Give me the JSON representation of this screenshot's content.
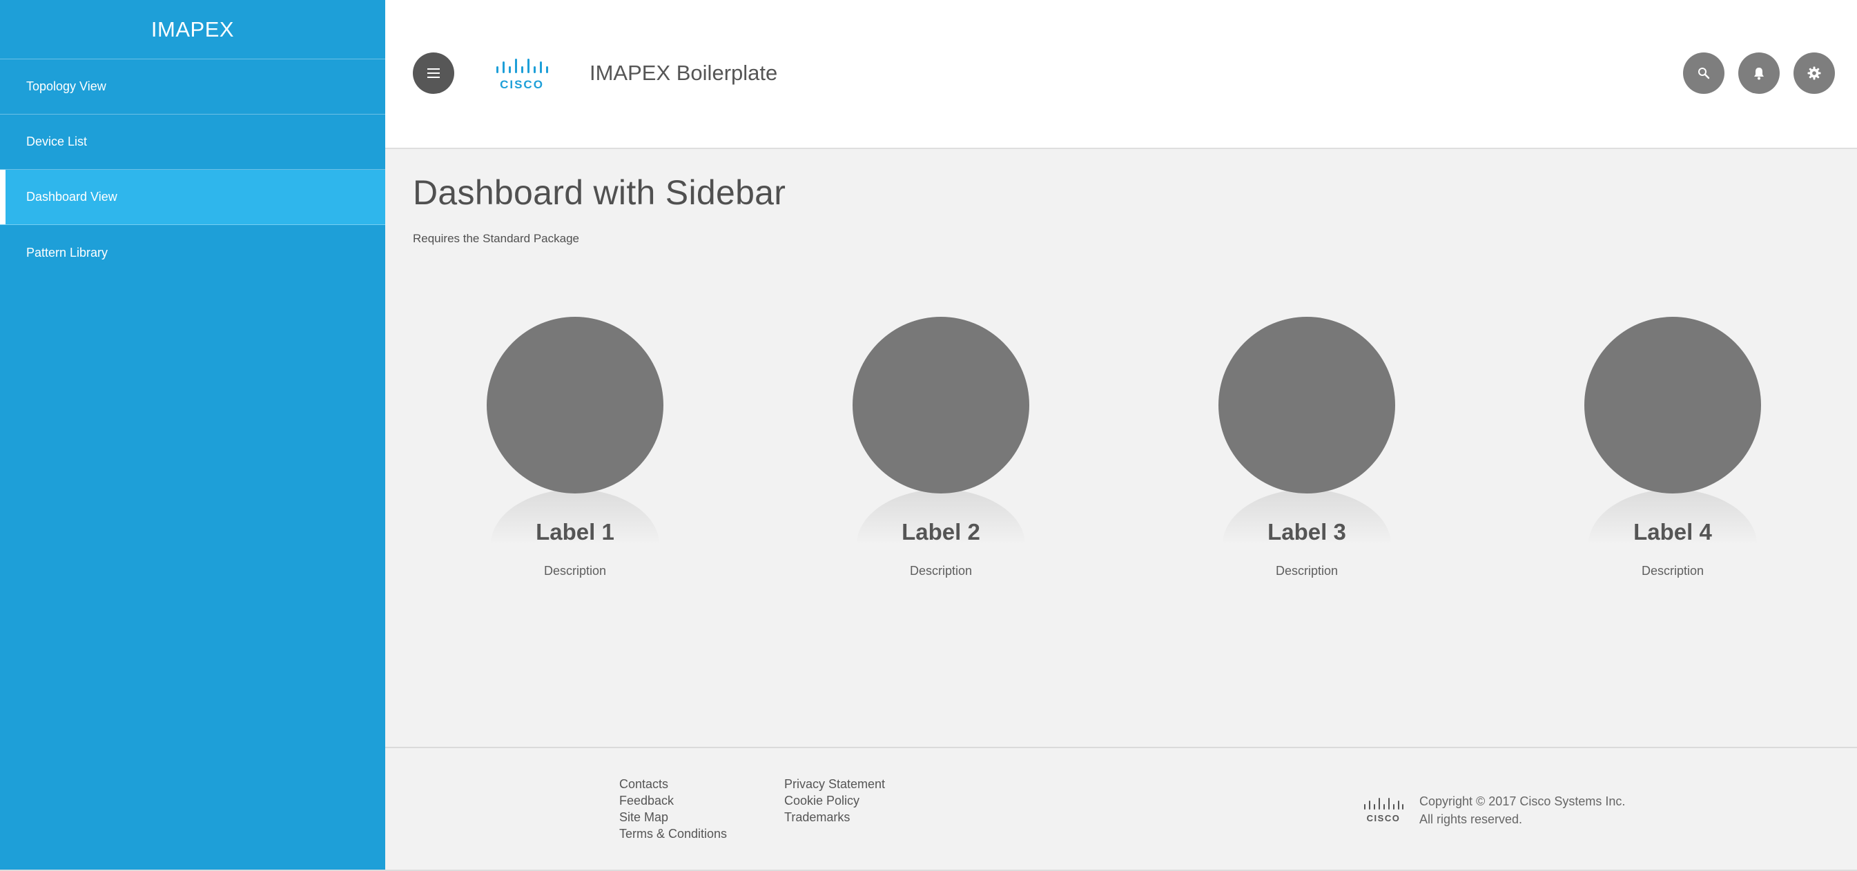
{
  "sidebar": {
    "title": "IMAPEX",
    "items": [
      {
        "label": "Topology View"
      },
      {
        "label": "Device List"
      },
      {
        "label": "Dashboard View"
      },
      {
        "label": "Pattern Library"
      }
    ],
    "active_item": "Dashboard View"
  },
  "header": {
    "logo_text": "CISCO",
    "title": "IMAPEX Boilerplate",
    "menu_icon": "hamburger-menu-icon",
    "icons": [
      "search-icon",
      "bell-icon",
      "gear-icon"
    ]
  },
  "main": {
    "title": "Dashboard with Sidebar",
    "subtitle": "Requires the Standard Package",
    "cards": [
      {
        "label": "Label 1",
        "description": "Description"
      },
      {
        "label": "Label 2",
        "description": "Description"
      },
      {
        "label": "Label 3",
        "description": "Description"
      },
      {
        "label": "Label 4",
        "description": "Description"
      }
    ]
  },
  "footer": {
    "links_col1": [
      "Contacts",
      "Feedback",
      "Site Map",
      "Terms & Conditions"
    ],
    "links_col2": [
      "Privacy Statement",
      "Cookie Policy",
      "Trademarks"
    ],
    "logo_text": "CISCO",
    "copyright_line1": "Copyright © 2017 Cisco Systems Inc.",
    "copyright_line2": "All rights reserved."
  },
  "colors": {
    "sidebar_bg": "#1e9fd8",
    "sidebar_active": "#2fb6ec",
    "brand_blue": "#1e9fd8",
    "card_circle": "#787878",
    "main_bg": "#f2f2f2"
  }
}
